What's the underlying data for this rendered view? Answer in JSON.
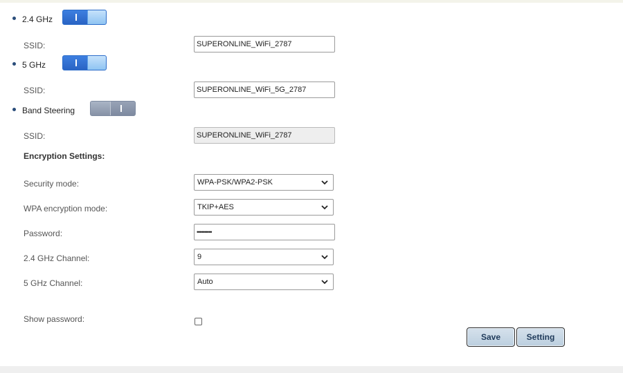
{
  "wifi": {
    "band24": {
      "label": "2.4 GHz",
      "enabled": true,
      "ssid_label": "SSID:",
      "ssid_value": "SUPERONLINE_WiFi_2787"
    },
    "band5": {
      "label": "5 GHz",
      "enabled": true,
      "ssid_label": "SSID:",
      "ssid_value": "SUPERONLINE_WiFi_5G_2787"
    },
    "band_steering": {
      "label": "Band Steering",
      "enabled": false,
      "ssid_label": "SSID:",
      "ssid_value": "SUPERONLINE_WiFi_2787"
    }
  },
  "encryption": {
    "heading": "Encryption Settings:",
    "security_mode": {
      "label": "Security mode:",
      "value": "WPA-PSK/WPA2-PSK"
    },
    "wpa_mode": {
      "label": "WPA encryption mode:",
      "value": "TKIP+AES"
    },
    "password": {
      "label": "Password:",
      "value": "••••••••••"
    },
    "channel24": {
      "label": "2.4 GHz Channel:",
      "value": "9"
    },
    "channel5": {
      "label": "5 GHz Channel:",
      "value": "Auto"
    },
    "show_password": {
      "label": "Show password:",
      "checked": false
    }
  },
  "buttons": {
    "save": "Save",
    "setting": "Setting"
  },
  "colors": {
    "toggle_on": "#2f6fd6",
    "toggle_off": "#8d99ad",
    "button_bg": "#c9d8e6",
    "bullet": "#2a4d7a"
  }
}
